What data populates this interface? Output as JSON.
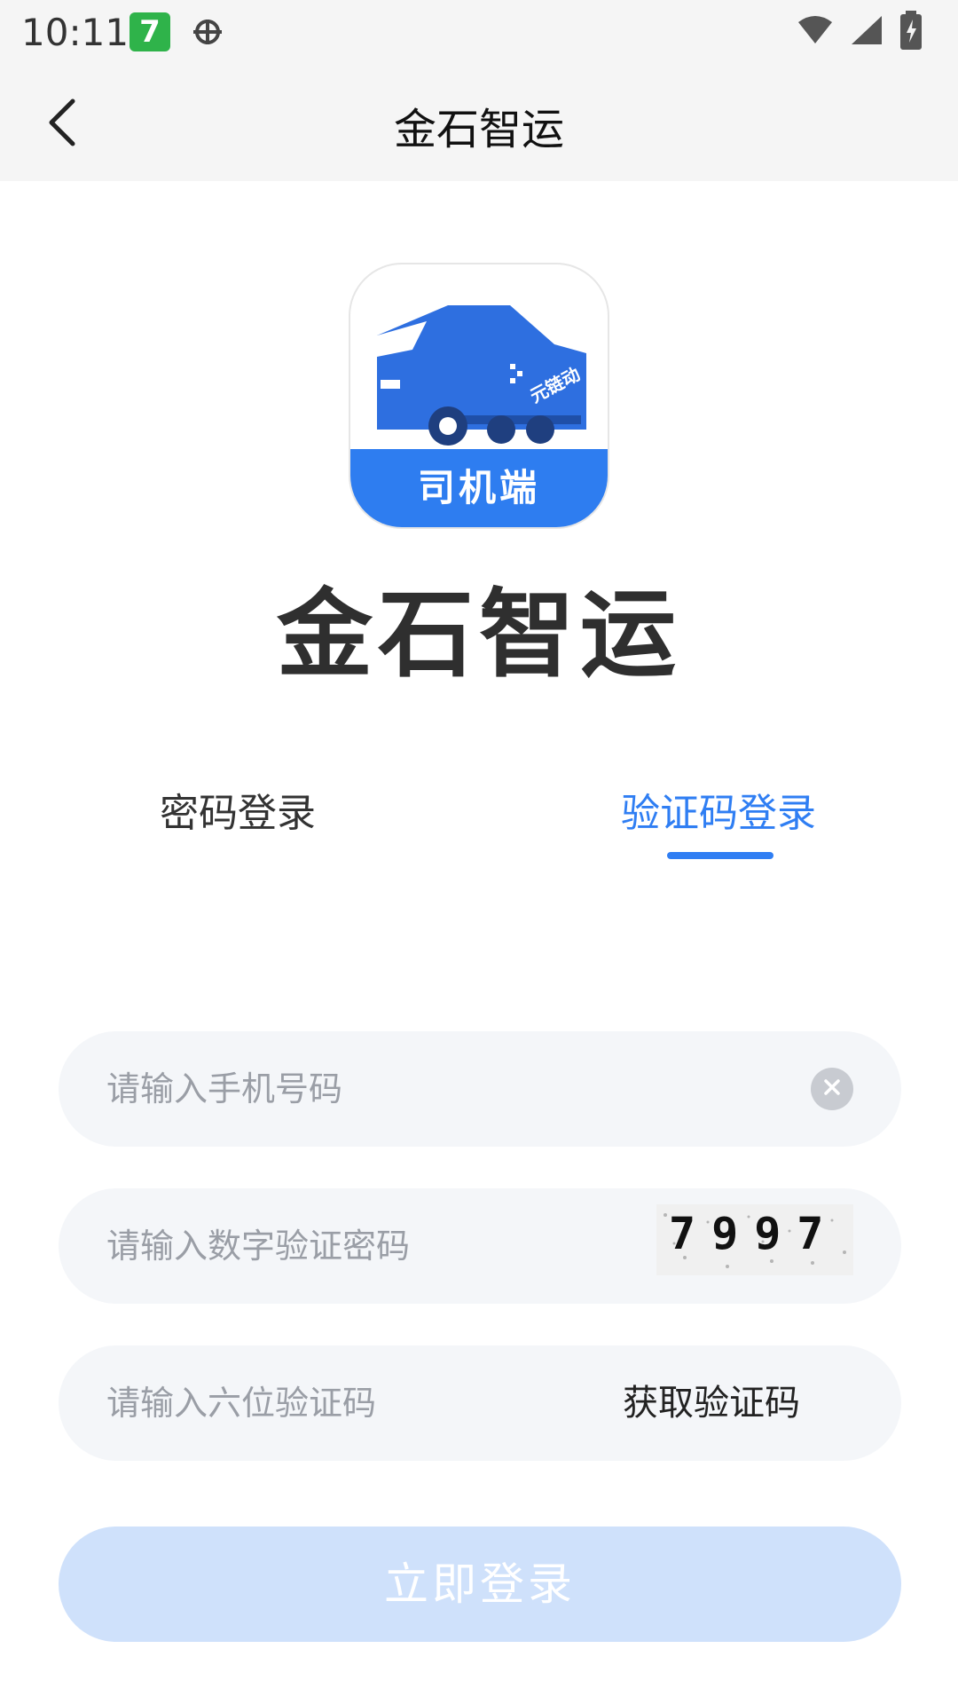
{
  "status_bar": {
    "time": "10:11",
    "badge_text": "7",
    "icons": [
      "wifi-icon",
      "signal-icon",
      "battery-charging-icon"
    ]
  },
  "app_bar": {
    "back_icon": "chevron-left-icon",
    "title": "金石智运"
  },
  "logo": {
    "banner_text": "司机端",
    "truck_label": "元链动",
    "brand_name": "金石智运"
  },
  "tabs": [
    {
      "label": "密码登录",
      "active": false
    },
    {
      "label": "验证码登录",
      "active": true
    }
  ],
  "form": {
    "phone": {
      "placeholder": "请输入手机号码",
      "value": ""
    },
    "captcha": {
      "placeholder": "请输入数字验证密码",
      "value": "",
      "captcha_text": "7997"
    },
    "sms_code": {
      "placeholder": "请输入六位验证码",
      "value": "",
      "get_code_label": "获取验证码"
    }
  },
  "login_button": {
    "label": "立即登录"
  },
  "colors": {
    "accent": "#2f7ef3",
    "field_bg": "#f4f6f9",
    "button_disabled": "#cfe1fb",
    "header_bg": "#f5f5f5"
  }
}
